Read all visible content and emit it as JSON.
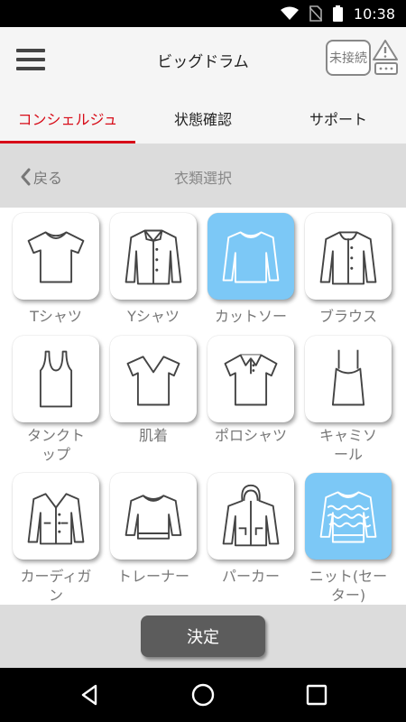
{
  "status_bar": {
    "time": "10:38"
  },
  "app_bar": {
    "title": "ビッグドラム",
    "connection_status": "未接続"
  },
  "tabs": [
    {
      "label": "コンシェルジュ",
      "active": true
    },
    {
      "label": "状態確認",
      "active": false
    },
    {
      "label": "サポート",
      "active": false
    }
  ],
  "subheader": {
    "back_label": "戻る",
    "title": "衣類選択"
  },
  "clothes": [
    {
      "label": "Tシャツ",
      "icon": "t-shirt-icon",
      "selected": false
    },
    {
      "label": "Yシャツ",
      "icon": "dress-shirt-icon",
      "selected": false
    },
    {
      "label": "カットソー",
      "icon": "cut-and-sewn-icon",
      "selected": true
    },
    {
      "label": "ブラウス",
      "icon": "blouse-icon",
      "selected": false
    },
    {
      "label": "タンクト\nップ",
      "icon": "tank-top-icon",
      "selected": false
    },
    {
      "label": "肌着",
      "icon": "undershirt-icon",
      "selected": false
    },
    {
      "label": "ポロシャツ",
      "icon": "polo-shirt-icon",
      "selected": false
    },
    {
      "label": "キャミソ\nール",
      "icon": "camisole-icon",
      "selected": false
    },
    {
      "label": "カーディガ\nン",
      "icon": "cardigan-icon",
      "selected": false
    },
    {
      "label": "トレーナー",
      "icon": "sweatshirt-icon",
      "selected": false
    },
    {
      "label": "パーカー",
      "icon": "hoodie-icon",
      "selected": false
    },
    {
      "label": "ニット(セー\nター)",
      "icon": "knit-sweater-icon",
      "selected": true
    }
  ],
  "footer": {
    "decide_label": "決定"
  },
  "colors": {
    "accent": "#d70c18",
    "selected_tile": "#7cc8f6",
    "button": "#5c5c5c"
  }
}
